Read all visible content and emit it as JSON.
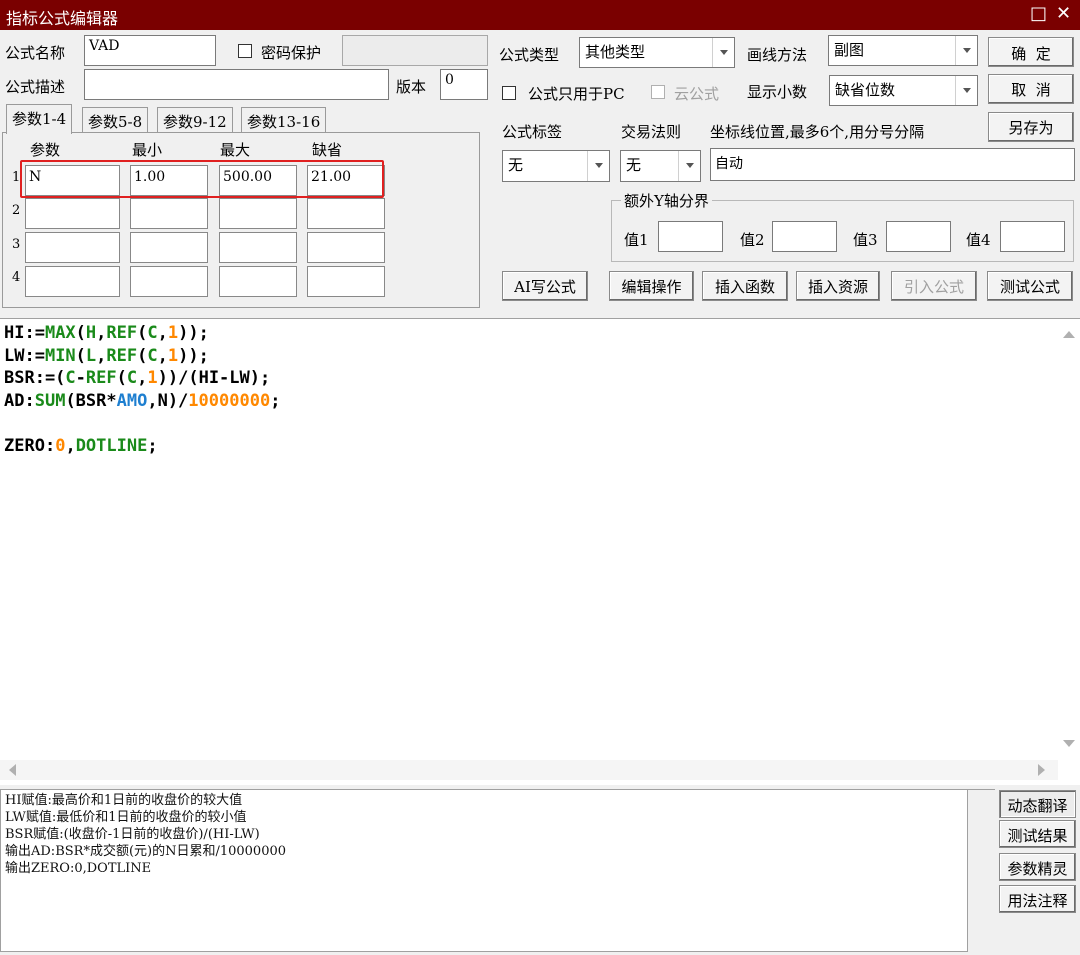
{
  "window": {
    "title": "指标公式编辑器",
    "maximize_icon": "□",
    "close_icon": "✕"
  },
  "header": {
    "name_label": "公式名称",
    "name_value": "VAD",
    "password_label": "密码保护",
    "password_checked": false,
    "desc_label": "公式描述",
    "desc_value": "",
    "version_label": "版本",
    "version_value": "0",
    "type_label": "公式类型",
    "type_value": "其他类型",
    "draw_label": "画线方法",
    "draw_value": "副图",
    "pc_only_label": "公式只用于PC",
    "cloud_label": "云公式",
    "decimals_label": "显示小数",
    "decimals_value": "缺省位数",
    "tag_label": "公式标签",
    "tag_value": "无",
    "trade_label": "交易法则",
    "trade_value": "无",
    "axis_label": "坐标线位置,最多6个,用分号分隔",
    "axis_value": "自动",
    "extra_y_title": "额外Y轴分界",
    "y_labels": [
      "值1",
      "值2",
      "值3",
      "值4"
    ]
  },
  "buttons": {
    "ok": "确  定",
    "cancel": "取  消",
    "save_as": "另存为",
    "ai_write": "AI写公式",
    "edit_ops": "编辑操作",
    "insert_func": "插入函数",
    "insert_res": "插入资源",
    "import_formula": "引入公式",
    "test_formula": "测试公式"
  },
  "tabs": [
    "参数1-4",
    "参数5-8",
    "参数9-12",
    "参数13-16"
  ],
  "params": {
    "headers": [
      "参数",
      "最小",
      "最大",
      "缺省"
    ],
    "rows": [
      {
        "num": "1",
        "name": "N",
        "min": "1.00",
        "max": "500.00",
        "default": "21.00"
      },
      {
        "num": "2",
        "name": "",
        "min": "",
        "max": "",
        "default": ""
      },
      {
        "num": "3",
        "name": "",
        "min": "",
        "max": "",
        "default": ""
      },
      {
        "num": "4",
        "name": "",
        "min": "",
        "max": "",
        "default": ""
      }
    ]
  },
  "code_lines": [
    [
      [
        "HI:=",
        "var"
      ],
      [
        "MAX",
        "fn"
      ],
      [
        "(",
        "var"
      ],
      [
        "H",
        "fn"
      ],
      [
        ",",
        "var"
      ],
      [
        "REF",
        "fn"
      ],
      [
        "(",
        "var"
      ],
      [
        "C",
        "fn"
      ],
      [
        ",",
        "var"
      ],
      [
        "1",
        "num"
      ],
      [
        "));",
        "var"
      ]
    ],
    [
      [
        "LW:=",
        "var"
      ],
      [
        "MIN",
        "fn"
      ],
      [
        "(",
        "var"
      ],
      [
        "L",
        "fn"
      ],
      [
        ",",
        "var"
      ],
      [
        "REF",
        "fn"
      ],
      [
        "(",
        "var"
      ],
      [
        "C",
        "fn"
      ],
      [
        ",",
        "var"
      ],
      [
        "1",
        "num"
      ],
      [
        "));",
        "var"
      ]
    ],
    [
      [
        "BSR:=(",
        "var"
      ],
      [
        "C",
        "fn"
      ],
      [
        "-",
        "var"
      ],
      [
        "REF",
        "fn"
      ],
      [
        "(",
        "var"
      ],
      [
        "C",
        "fn"
      ],
      [
        ",",
        "var"
      ],
      [
        "1",
        "num"
      ],
      [
        "))/(HI-LW);",
        "var"
      ]
    ],
    [
      [
        "AD:",
        "var"
      ],
      [
        "SUM",
        "fn"
      ],
      [
        "(BSR*",
        "var"
      ],
      [
        "AMO",
        "const"
      ],
      [
        ",N)/",
        "var"
      ],
      [
        "10000000",
        "num"
      ],
      [
        ";",
        "var"
      ]
    ],
    [
      [
        "",
        "var"
      ]
    ],
    [
      [
        "ZERO:",
        "var"
      ],
      [
        "0",
        "num"
      ],
      [
        ",",
        "var"
      ],
      [
        "DOTLINE",
        "fn"
      ],
      [
        ";",
        "var"
      ]
    ]
  ],
  "translation": [
    "HI赋值:最高价和1日前的收盘价的较大值",
    "LW赋值:最低价和1日前的收盘价的较小值",
    "BSR赋值:(收盘价-1日前的收盘价)/(HI-LW)",
    "输出AD:BSR*成交额(元)的N日累和/10000000",
    "输出ZERO:0,DOTLINE"
  ],
  "side_buttons": [
    "动态翻译",
    "测试结果",
    "参数精灵",
    "用法注释"
  ],
  "colors": {
    "title_bar": "#7a0000",
    "highlight": "#e02020",
    "code_function": "#1a8a1a",
    "code_number": "#ff8800",
    "code_constant": "#1e7fd0"
  }
}
